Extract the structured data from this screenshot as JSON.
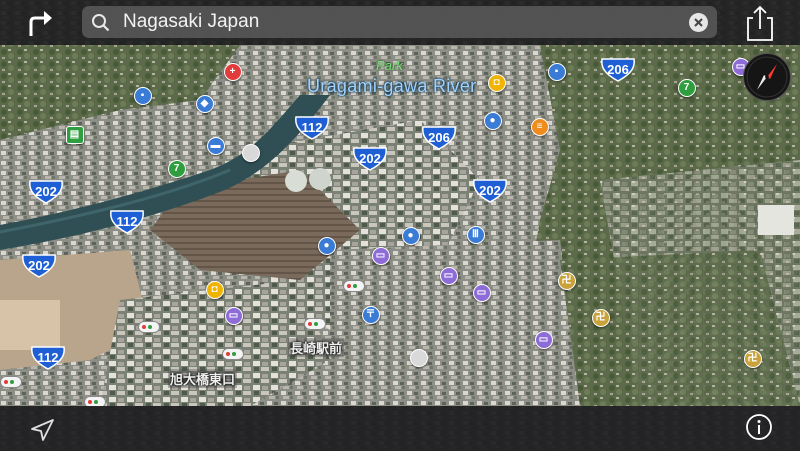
{
  "search": {
    "query": "Nagasaki Japan"
  },
  "map": {
    "river_label": "Uragami-gawa River",
    "park_label": "Park",
    "station_labels": [
      "長崎駅前",
      "旭大橋東口"
    ],
    "route_shields": [
      "206",
      "112",
      "202",
      "206",
      "202",
      "202",
      "112",
      "202",
      "112"
    ],
    "compass": {
      "icon": "compass-needle-icon",
      "north_color": "#ff3b30"
    }
  },
  "toolbar": {
    "directions_icon": "turn-arrow-icon",
    "share_icon": "share-icon",
    "location_icon": "location-arrow-icon",
    "info_icon": "info-icon",
    "clear_icon": "clear-icon",
    "search_icon": "search-icon"
  },
  "colors": {
    "bar": "#1c1c1e",
    "shield_blue": "#1f5fd6",
    "river_label": "#9fd3ff"
  }
}
